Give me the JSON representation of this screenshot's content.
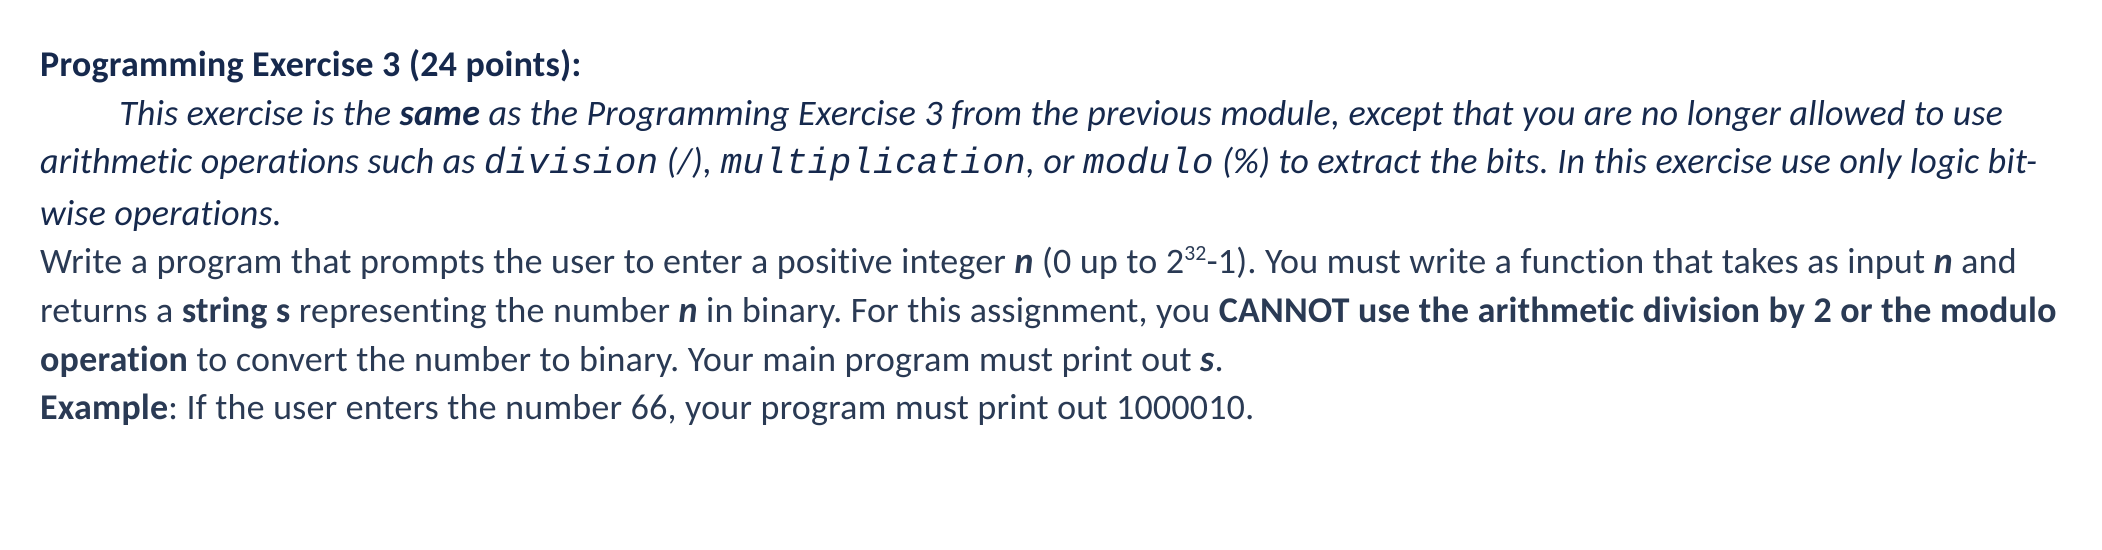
{
  "heading": "Programming Exercise 3 (24 points):",
  "intro": {
    "lead_in": "This exercise is the ",
    "same": "same",
    "after_same": " as the Programming Exercise 3 from the previous module, except that you are no longer allowed to use arithmetic operations such as ",
    "division": "division",
    "division_sym": " (/), ",
    "multiplication": "multiplication",
    "or": ", or ",
    "modulo": "modulo",
    "modulo_sym": " (%) to extract the bits. In this exercise use only logic bit-wise operations."
  },
  "body": {
    "s1a": "Write a program that prompts the user to enter a positive integer ",
    "n1": "n",
    "s1b": " (0 up to 2",
    "exp": "32",
    "s1c": "-1). You must write a function that takes as input ",
    "n2": "n",
    "s1d": " and returns a ",
    "string_s": "string s",
    "s1e": " representing the number ",
    "n3": "n",
    "s1f": " in binary. For this assignment, you ",
    "cannot": "CANNOT use the arithmetic division by 2 or the modulo operation",
    "s1g": " to convert the number to binary. Your main program must print out ",
    "s_var": "s",
    "s1h": "."
  },
  "example": {
    "label": "Example",
    "text": ": If the user enters the number 66, your program must print out 1000010."
  }
}
